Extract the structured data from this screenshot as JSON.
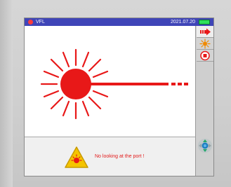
{
  "status_bar": {
    "title": "VFL",
    "date": "2021.07.20",
    "battery_color": "#2ee05a",
    "bar_color": "#3f45b8"
  },
  "main": {
    "laser_color": "#e81818",
    "warning": {
      "text": "No looking at the port !",
      "icon": "laser-warning-icon"
    }
  },
  "sidebar": {
    "buttons": [
      {
        "name": "output-arrow-icon"
      },
      {
        "name": "light-burst-icon"
      },
      {
        "name": "stop-record-icon"
      }
    ],
    "nav": {
      "name": "navigation-pad-icon"
    }
  }
}
